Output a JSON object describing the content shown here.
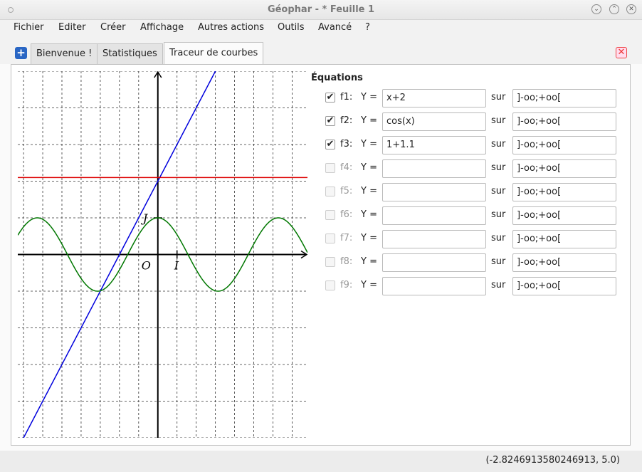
{
  "window": {
    "title": "Géophar - * Feuille 1",
    "minimize_glyph": "⌄",
    "maximize_glyph": "⌃",
    "close_glyph": "✕"
  },
  "menu": [
    {
      "id": "fichier",
      "label": "Fichier"
    },
    {
      "id": "editer",
      "label": "Editer"
    },
    {
      "id": "creer",
      "label": "Créer"
    },
    {
      "id": "affichage",
      "label": "Affichage"
    },
    {
      "id": "autres-actions",
      "label": "Autres actions"
    },
    {
      "id": "outils",
      "label": "Outils"
    },
    {
      "id": "avance",
      "label": "Avancé"
    },
    {
      "id": "help",
      "label": "?"
    }
  ],
  "tabs": {
    "add_glyph": "+",
    "close_glyph": "✕",
    "items": [
      {
        "label": "Bienvenue !",
        "active": false
      },
      {
        "label": "Statistiques",
        "active": false
      },
      {
        "label": "Traceur de courbes",
        "active": true
      }
    ]
  },
  "equations": {
    "title": "Équations",
    "y_label": "Y =",
    "sur_label": "sur",
    "check_glyph": "✔",
    "rows": [
      {
        "name": "f1:",
        "checked": true,
        "enabled": true,
        "expr": "x+2",
        "domain": "]-oo;+oo["
      },
      {
        "name": "f2:",
        "checked": true,
        "enabled": true,
        "expr": "cos(x)",
        "domain": "]-oo;+oo["
      },
      {
        "name": "f3:",
        "checked": true,
        "enabled": true,
        "expr": "1+1.1",
        "domain": "]-oo;+oo["
      },
      {
        "name": "f4:",
        "checked": false,
        "enabled": false,
        "expr": "",
        "domain": "]-oo;+oo["
      },
      {
        "name": "f5:",
        "checked": false,
        "enabled": false,
        "expr": "",
        "domain": "]-oo;+oo["
      },
      {
        "name": "f6:",
        "checked": false,
        "enabled": false,
        "expr": "",
        "domain": "]-oo;+oo["
      },
      {
        "name": "f7:",
        "checked": false,
        "enabled": false,
        "expr": "",
        "domain": "]-oo;+oo["
      },
      {
        "name": "f8:",
        "checked": false,
        "enabled": false,
        "expr": "",
        "domain": "]-oo;+oo["
      },
      {
        "name": "f9:",
        "checked": false,
        "enabled": false,
        "expr": "",
        "domain": "]-oo;+oo["
      }
    ]
  },
  "graph": {
    "xlim": [
      -7.3,
      7.8
    ],
    "ylim": [
      -5.0,
      5.0
    ],
    "grid": true,
    "origin_label": "O",
    "unit_x_label": "I",
    "unit_y_label": "J",
    "curves": [
      {
        "name": "f1",
        "color": "#0000dd"
      },
      {
        "name": "f2",
        "color": "#007700"
      },
      {
        "name": "f3",
        "color": "#dd0000"
      }
    ]
  },
  "status": {
    "coordinates": "(-2.8246913580246913, 5.0)"
  }
}
